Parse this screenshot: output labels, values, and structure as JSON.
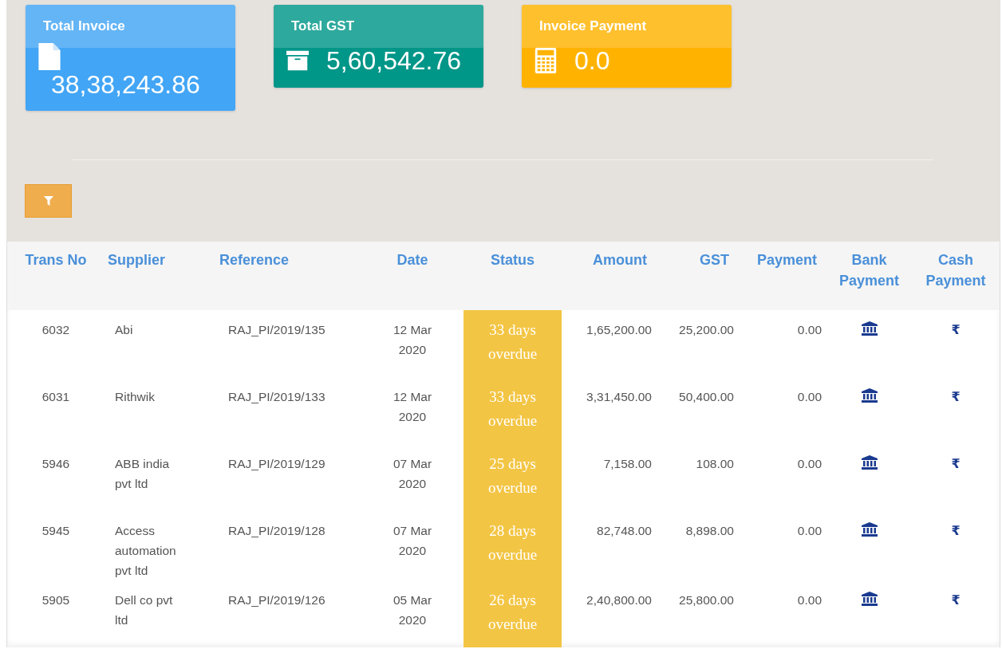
{
  "cards": [
    {
      "title": "Total Invoice",
      "value": "38,38,243.86",
      "kind": "file",
      "color": "#42a5f5",
      "value_wrapped": true
    },
    {
      "title": "Total GST",
      "value": "5,60,542.76",
      "kind": "archive",
      "color": "#009688",
      "value_wrapped": false
    },
    {
      "title": "Invoice Payment",
      "value": "0.0",
      "kind": "calculator",
      "color": "#ffb300",
      "value_wrapped": false
    }
  ],
  "table": {
    "columns": [
      "Trans No",
      "Supplier",
      "Reference",
      "Date",
      "Status",
      "Amount",
      "GST",
      "Payment",
      "Bank Payment",
      "Cash Payment"
    ],
    "rows": [
      {
        "trans_no": "6032",
        "supplier": "Abi",
        "reference": "RAJ_PI/2019/135",
        "date": "12 Mar 2020",
        "status": "33 days overdue",
        "amount": "1,65,200.00",
        "gst": "25,200.00",
        "payment": "0.00",
        "cash": "₹"
      },
      {
        "trans_no": "6031",
        "supplier": "Rithwik",
        "reference": "RAJ_PI/2019/133",
        "date": "12 Mar 2020",
        "status": "33 days overdue",
        "amount": "3,31,450.00",
        "gst": "50,400.00",
        "payment": "0.00",
        "cash": "₹"
      },
      {
        "trans_no": "5946",
        "supplier": "ABB india pvt ltd",
        "reference": "RAJ_PI/2019/129",
        "date": "07 Mar 2020",
        "status": "25 days overdue",
        "amount": "7,158.00",
        "gst": "108.00",
        "payment": "0.00",
        "cash": "₹"
      },
      {
        "trans_no": "5945",
        "supplier": "Access automation pvt ltd",
        "reference": "RAJ_PI/2019/128",
        "date": "07 Mar 2020",
        "status": "28 days overdue",
        "amount": "82,748.00",
        "gst": "8,898.00",
        "payment": "0.00",
        "cash": "₹"
      },
      {
        "trans_no": "5905",
        "supplier": "Dell co pvt ltd",
        "reference": "RAJ_PI/2019/126",
        "date": "05 Mar 2020",
        "status": "26 days overdue",
        "amount": "2,40,800.00",
        "gst": "25,800.00",
        "payment": "0.00",
        "cash": "₹"
      }
    ]
  }
}
